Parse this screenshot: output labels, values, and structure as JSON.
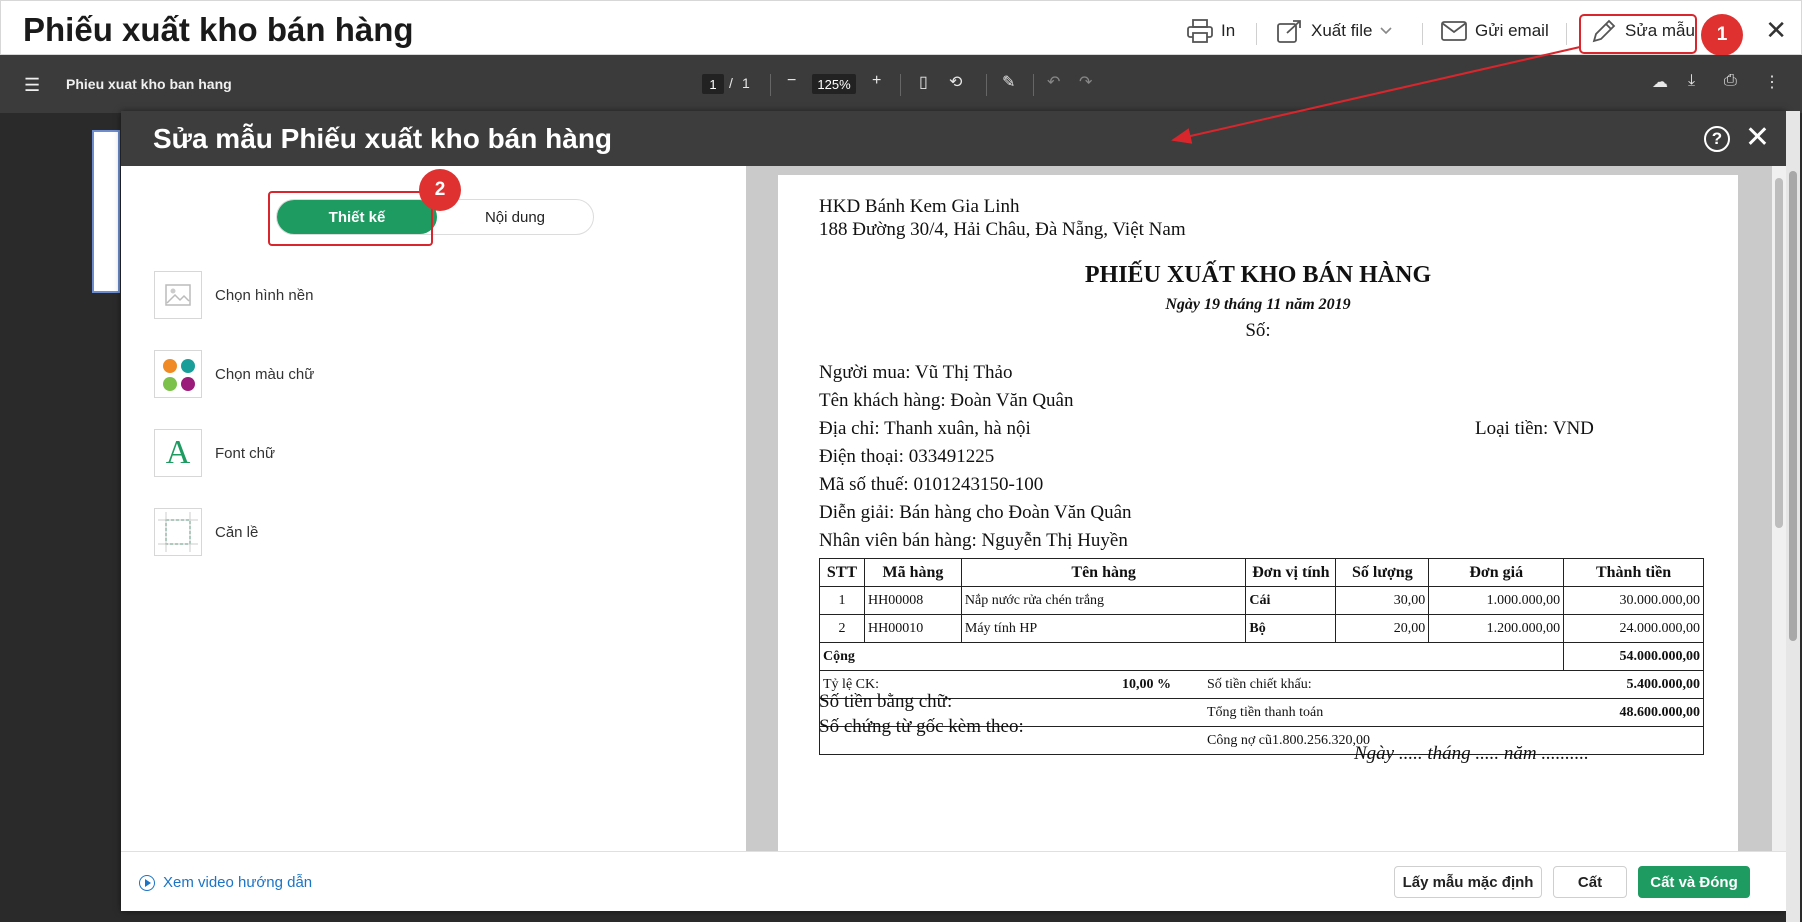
{
  "app": {
    "title": "Phiếu xuất kho bán hàng",
    "actions": {
      "print": "In",
      "export": "Xuất file",
      "email": "Gửi email",
      "edit_template": "Sửa mẫu"
    },
    "close": "✕"
  },
  "pdf_toolbar": {
    "doc_name": "Phieu xuat kho ban hang",
    "page_current": "1",
    "page_sep": "/",
    "page_total": "1",
    "zoom": "125%"
  },
  "badges": {
    "one": "1",
    "two": "2"
  },
  "modal": {
    "title": "Sửa mẫu Phiếu xuất kho bán hàng",
    "tabs": {
      "design": "Thiết kế",
      "content": "Nội dung"
    },
    "options": {
      "background": "Chọn hình nền",
      "text_color": "Chọn màu chữ",
      "font": "Font chữ",
      "margin": "Căn lề"
    },
    "font_glyph": "A",
    "footer": {
      "video_link": "Xem video hướng dẫn",
      "default_template": "Lấy mẫu mặc định",
      "save": "Cất",
      "save_close": "Cất và Đóng"
    }
  },
  "document": {
    "company": "HKD Bánh Kem Gia Linh",
    "address": "188 Đường 30/4, Hải Châu, Đà Nẵng, Việt Nam",
    "title": "PHIẾU XUẤT KHO BÁN HÀNG",
    "date": "Ngày 19 tháng 11 năm 2019",
    "number": "Số:",
    "buyer": "Người mua: Vũ Thị Thảo",
    "customer": "Tên khách hàng: Đoàn Văn Quân",
    "addr_line": "Địa chỉ: Thanh xuân, hà nội",
    "currency": "Loại tiền: VND",
    "phone": "Điện thoại: 033491225",
    "tax_code": "Mã số thuế: 0101243150-100",
    "description": "Diễn giải: Bán hàng cho Đoàn Văn Quân",
    "salesperson": "Nhân viên bán hàng: Nguyễn Thị Huyền",
    "table": {
      "headers": [
        "STT",
        "Mã hàng",
        "Tên hàng",
        "Đơn vị tính",
        "Số lượng",
        "Đơn giá",
        "Thành tiền"
      ],
      "rows": [
        [
          "1",
          "HH00008",
          "Nắp nước rửa chén trắng",
          "Cái",
          "30,00",
          "1.000.000,00",
          "30.000.000,00"
        ],
        [
          "2",
          "HH00010",
          "Máy tính HP",
          "Bộ",
          "20,00",
          "1.200.000,00",
          "24.000.000,00"
        ]
      ],
      "total_label": "Cộng",
      "total_value": "54.000.000,00",
      "discount_rate_label": "Tỷ lệ CK:",
      "discount_rate": "10,00 %",
      "discount_amount_label": "Số tiền chiết khấu:",
      "discount_amount": "5.400.000,00",
      "grand_total_label": "Tổng tiền thanh toán",
      "grand_total": "48.600.000,00",
      "old_debt": "Công nợ cũ1.800.256.320,00"
    },
    "amount_words": "Số tiền bằng chữ:",
    "attached": "Số chứng từ gốc kèm theo:",
    "sign_date": "Ngày ..... tháng ..... năm .........."
  },
  "colors": {
    "accent": "#1e9b61",
    "callout": "#e03131",
    "header_dark": "#3d3d3d",
    "link": "#1b74c6"
  }
}
